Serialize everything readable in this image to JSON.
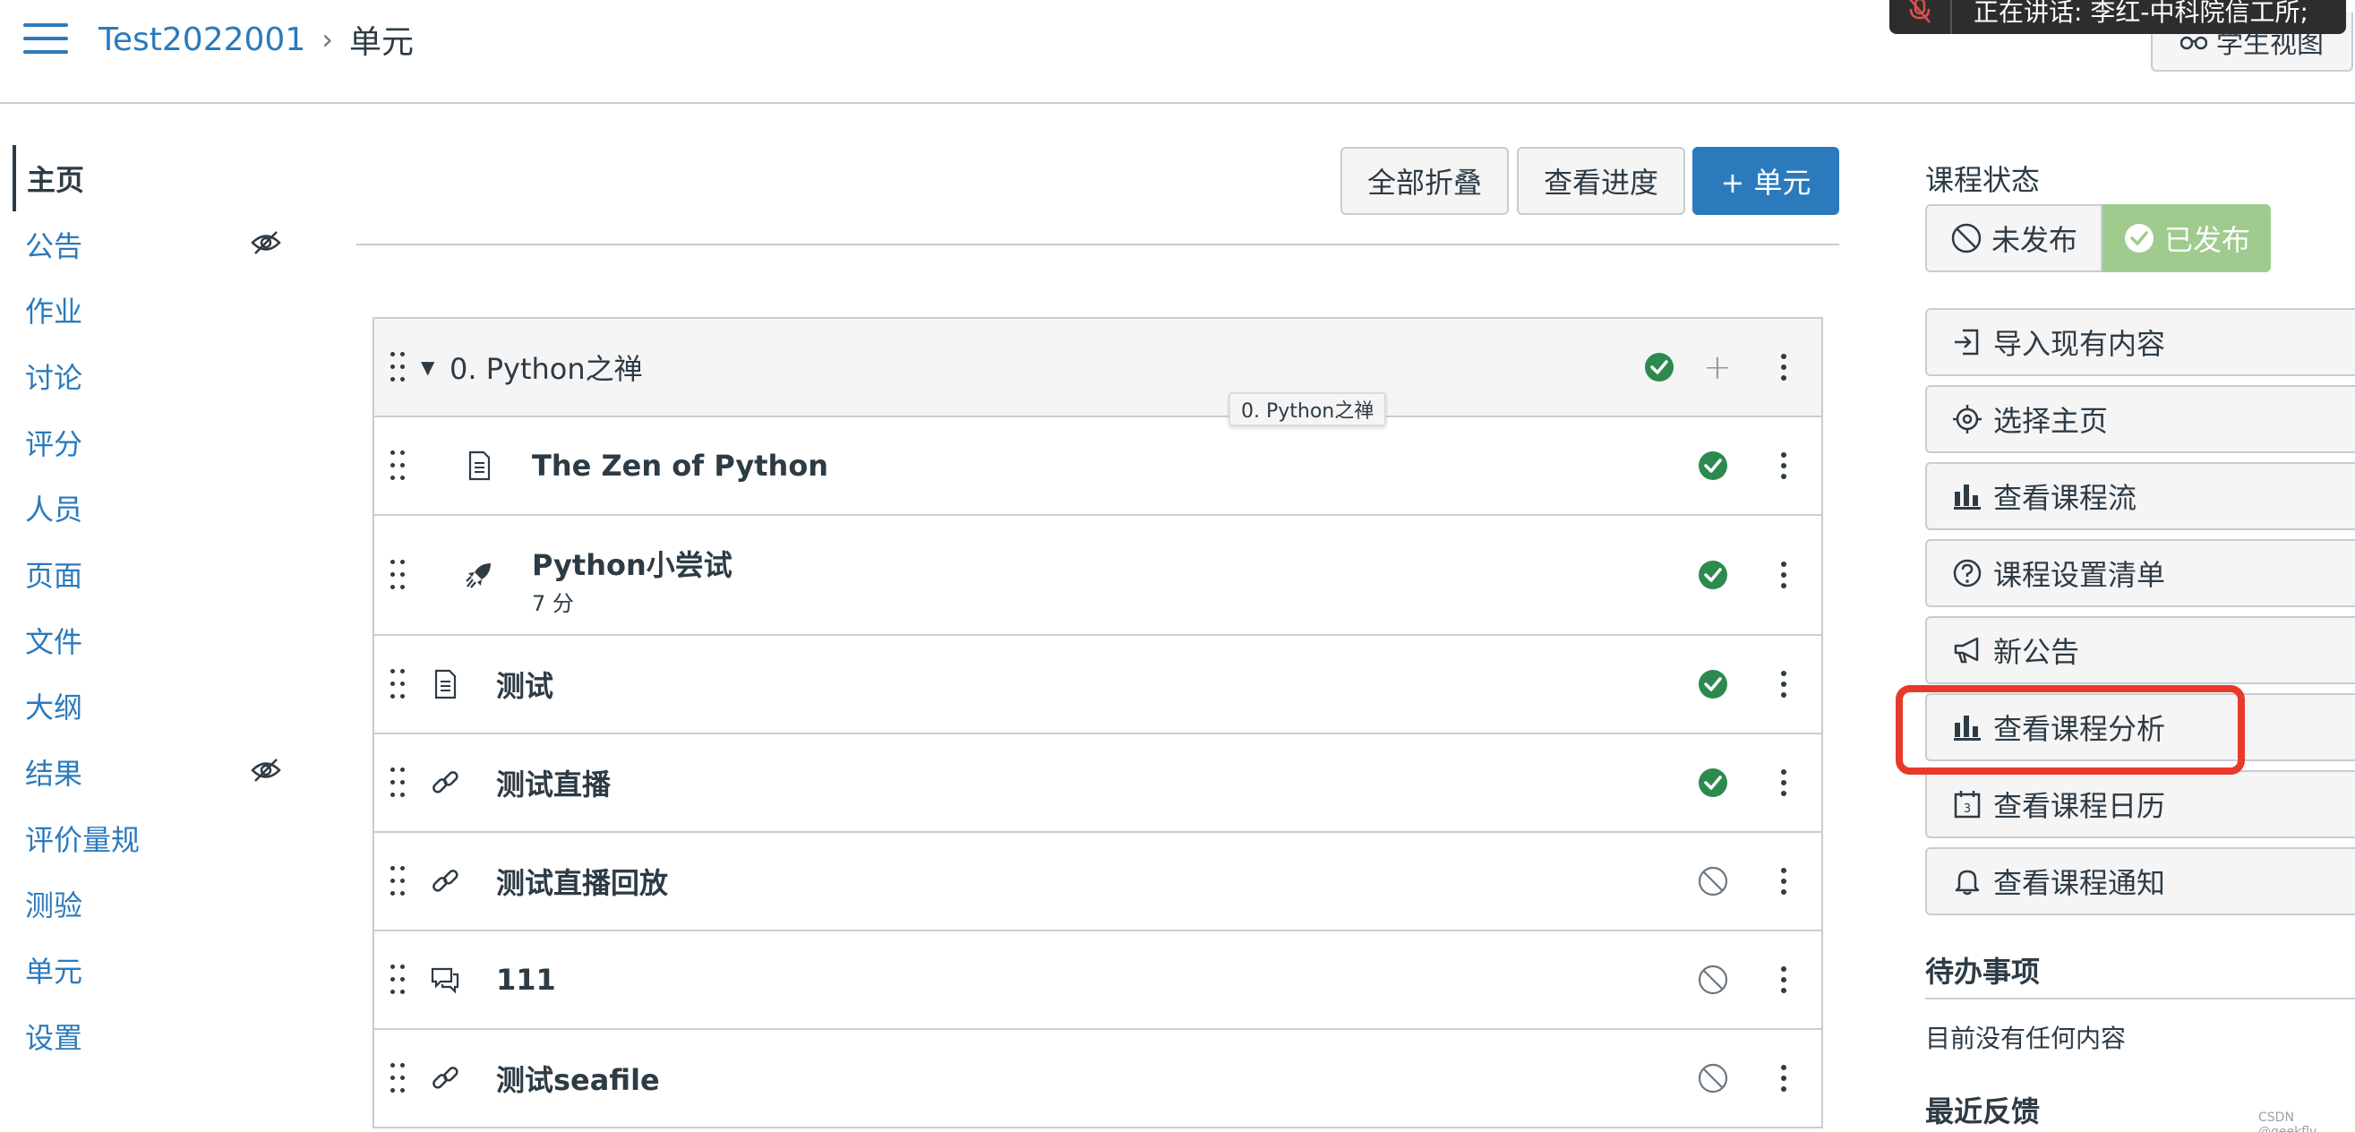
{
  "header": {
    "course": "Test2022001",
    "separator": "›",
    "current": "单元",
    "toast": "正在讲话: 李红-中科院信工所;",
    "student_view": "学生视图"
  },
  "nav": [
    {
      "label": "主页",
      "active": true
    },
    {
      "label": "公告",
      "hidden_icon": true
    },
    {
      "label": "作业"
    },
    {
      "label": "讨论"
    },
    {
      "label": "评分"
    },
    {
      "label": "人员"
    },
    {
      "label": "页面"
    },
    {
      "label": "文件"
    },
    {
      "label": "大纲"
    },
    {
      "label": "结果",
      "hidden_icon": true
    },
    {
      "label": "评价量规"
    },
    {
      "label": "测验"
    },
    {
      "label": "单元"
    },
    {
      "label": "设置"
    }
  ],
  "toolbar": {
    "collapse_all": "全部折叠",
    "view_progress": "查看进度",
    "add_module": "+ 单元"
  },
  "module": {
    "title": "0. Python之禅",
    "tooltip": "0. Python之禅",
    "items": [
      {
        "title": "The Zen of Python",
        "icon": "page-icon",
        "indent": true,
        "published": true
      },
      {
        "title": "Python小尝试",
        "subtitle": "7 分",
        "icon": "quiz-rocket-icon",
        "indent": true,
        "published": true
      },
      {
        "title": "测试",
        "icon": "page-icon",
        "published": true
      },
      {
        "title": "测试直播",
        "icon": "link-icon",
        "published": true
      },
      {
        "title": "测试直播回放",
        "icon": "link-icon",
        "published": false
      },
      {
        "title": "111",
        "icon": "discussion-icon",
        "published": false
      },
      {
        "title": "测试seafile",
        "icon": "link-icon",
        "published": false
      }
    ]
  },
  "sidebar": {
    "course_status_heading": "课程状态",
    "unpublished": "未发布",
    "published": "已发布",
    "buttons": [
      {
        "label": "导入现有内容",
        "icon": "import-icon"
      },
      {
        "label": "选择主页",
        "icon": "target-icon"
      },
      {
        "label": "查看课程流",
        "icon": "bar-chart-icon"
      },
      {
        "label": "课程设置清单",
        "icon": "question-icon"
      },
      {
        "label": "新公告",
        "icon": "megaphone-icon"
      },
      {
        "label": "查看课程分析",
        "icon": "bar-chart-icon"
      },
      {
        "label": "查看课程日历",
        "icon": "calendar-icon"
      },
      {
        "label": "查看课程通知",
        "icon": "bell-icon"
      }
    ],
    "todo_heading": "待办事项",
    "todo_empty": "目前没有任何内容",
    "feedback_heading": "最近反馈"
  },
  "watermark": "CSDN @geekfly",
  "colors": {
    "link": "#2b7abc",
    "published_green": "#2d8a4e",
    "annotation_red": "#e8392a"
  }
}
